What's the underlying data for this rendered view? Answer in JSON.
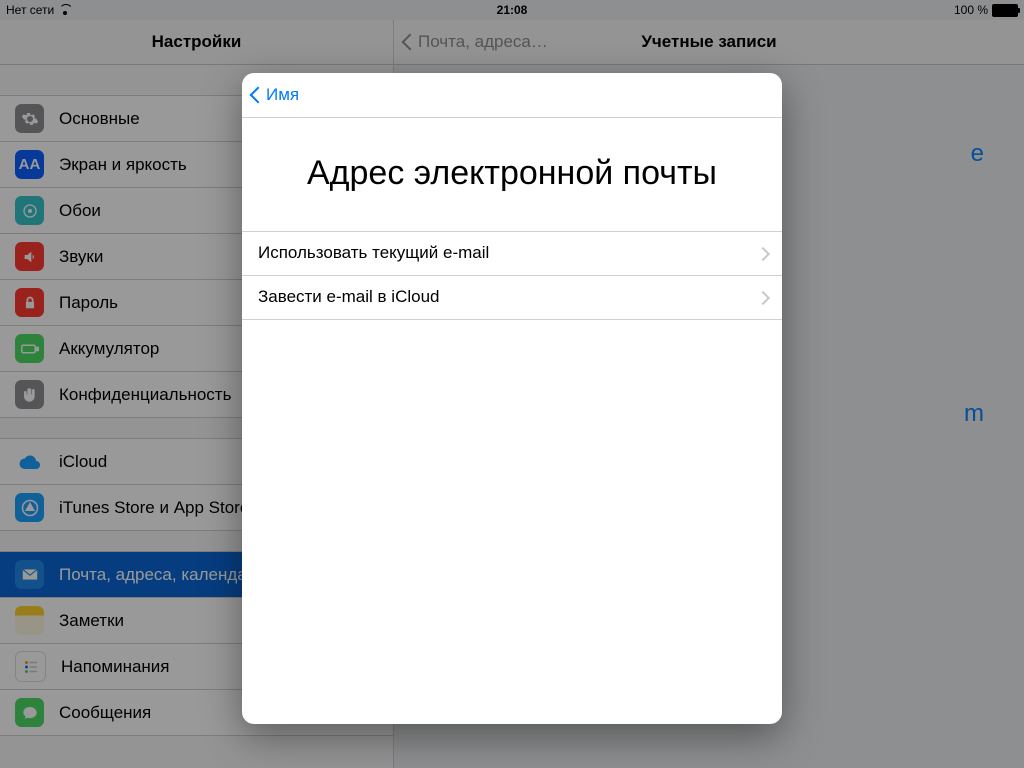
{
  "status": {
    "network": "Нет сети",
    "time": "21:08",
    "battery": "100 %"
  },
  "sidebar": {
    "title": "Настройки",
    "groups": [
      {
        "items": [
          {
            "name": "general",
            "label": "Основные"
          },
          {
            "name": "display",
            "label": "Экран и яркость"
          },
          {
            "name": "wallpaper",
            "label": "Обои"
          },
          {
            "name": "sounds",
            "label": "Звуки"
          },
          {
            "name": "passcode",
            "label": "Пароль"
          },
          {
            "name": "battery",
            "label": "Аккумулятор"
          },
          {
            "name": "privacy",
            "label": "Конфиденциальность"
          }
        ]
      },
      {
        "items": [
          {
            "name": "icloud",
            "label": "iCloud"
          },
          {
            "name": "itunes",
            "label": "iTunes Store и App Store"
          }
        ]
      },
      {
        "items": [
          {
            "name": "mail",
            "label": "Почта, адреса, календари",
            "selected": true
          },
          {
            "name": "notes",
            "label": "Заметки"
          },
          {
            "name": "reminders",
            "label": "Напоминания"
          },
          {
            "name": "messages",
            "label": "Сообщения"
          }
        ]
      }
    ]
  },
  "detail": {
    "back": "Почта, адреса…",
    "title": "Учетные записи",
    "link_a_suffix": "e",
    "link_b_suffix": "m"
  },
  "modal": {
    "back": "Имя",
    "title": "Адрес электронной почты",
    "options": [
      {
        "label": "Использовать текущий e-mail"
      },
      {
        "label": "Завести e-mail в iCloud"
      }
    ]
  }
}
